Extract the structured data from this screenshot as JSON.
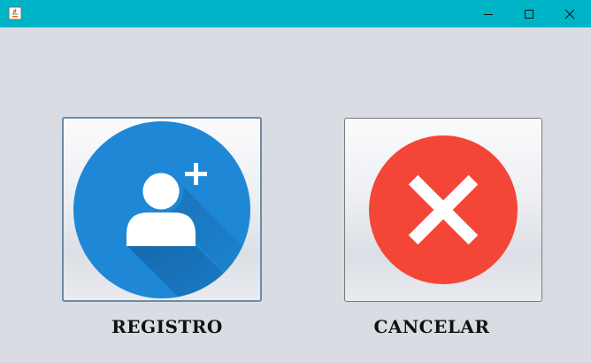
{
  "window": {
    "title": "",
    "titlebar_color": "#00b4c8",
    "background_color": "#d9dce2",
    "controls": [
      "minimize-icon",
      "maximize-icon",
      "close-icon"
    ]
  },
  "buttons": {
    "registro": {
      "label": "REGISTRO",
      "icon": "add-user-icon",
      "icon_color": "#1e88d6",
      "focused": true
    },
    "cancelar": {
      "label": "CANCELAR",
      "icon": "cancel-x-icon",
      "icon_color": "#f44637",
      "focused": false
    }
  }
}
